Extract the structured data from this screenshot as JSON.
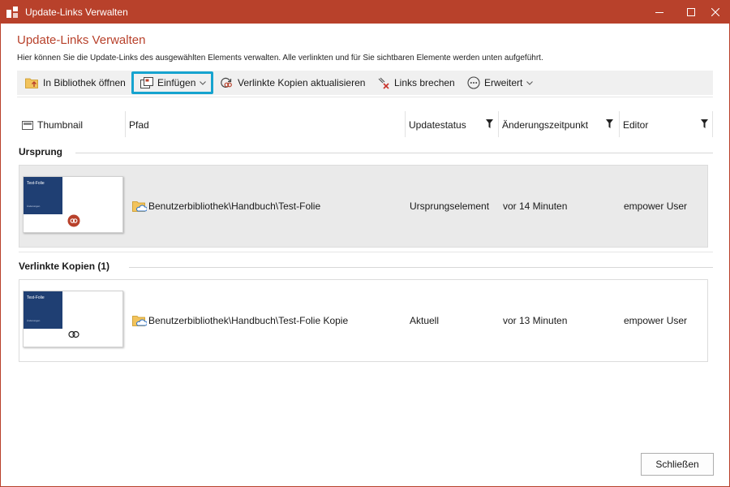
{
  "window": {
    "title": "Update-Links Verwalten",
    "accent_color": "#b8412b",
    "focus_color": "#16a3cf"
  },
  "dialog": {
    "title": "Update-Links Verwalten",
    "description": "Hier können Sie die Update-Links des ausgewählten Elements verwalten. Alle verlinkten und für Sie sichtbaren Elemente werden unten aufgeführt."
  },
  "toolbar": {
    "open_in_library": "In Bibliothek öffnen",
    "insert": "Einfügen",
    "update_linked_copies": "Verlinkte Kopien aktualisieren",
    "break_links": "Links brechen",
    "advanced": "Erweitert"
  },
  "columns": {
    "thumbnail": "Thumbnail",
    "path": "Pfad",
    "update_status": "Updatestatus",
    "modified": "Änderungszeitpunkt",
    "editor": "Editor"
  },
  "groups": [
    {
      "title": "Ursprung",
      "rows": [
        {
          "thumb_title": "Test-Folie",
          "thumb_subtitle": "Änderungen",
          "path": "Benutzerbibliothek\\Handbuch\\Test-Folie",
          "status": "Ursprungselement",
          "modified": "vor 14 Minuten",
          "editor": "empower User"
        }
      ]
    },
    {
      "title": "Verlinkte Kopien (1)",
      "rows": [
        {
          "thumb_title": "Test-Folie",
          "thumb_subtitle": "Änderungen",
          "path": "Benutzerbibliothek\\Handbuch\\Test-Folie Kopie",
          "status": "Aktuell",
          "modified": "vor 13 Minuten",
          "editor": "empower User"
        }
      ]
    }
  ],
  "footer": {
    "close": "Schließen"
  }
}
